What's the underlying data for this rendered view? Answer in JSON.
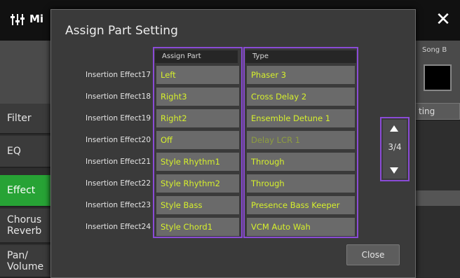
{
  "app": {
    "title": "Mi",
    "close_glyph": "✕",
    "song_label": "Song B",
    "partial_button": "ting"
  },
  "sidebar": {
    "tabs": [
      {
        "label": "Filter",
        "active": false
      },
      {
        "label": "EQ",
        "active": false
      },
      {
        "label": "Effect",
        "active": true
      },
      {
        "label": "Chorus Reverb",
        "active": false
      },
      {
        "label": "Pan/ Volume",
        "active": false
      }
    ]
  },
  "dialog": {
    "title": "Assign Part Setting",
    "columns": {
      "assign_part": "Assign Part",
      "type": "Type"
    },
    "rows": [
      {
        "label": "Insertion Effect17",
        "part": "Left",
        "type": "Phaser 3",
        "type_dim": false
      },
      {
        "label": "Insertion Effect18",
        "part": "Right3",
        "type": "Cross Delay 2",
        "type_dim": false
      },
      {
        "label": "Insertion Effect19",
        "part": "Right2",
        "type": "Ensemble Detune 1",
        "type_dim": false
      },
      {
        "label": "Insertion Effect20",
        "part": "Off",
        "type": "Delay LCR 1",
        "type_dim": true
      },
      {
        "label": "Insertion Effect21",
        "part": "Style Rhythm1",
        "type": "Through",
        "type_dim": false
      },
      {
        "label": "Insertion Effect22",
        "part": "Style Rhythm2",
        "type": "Through",
        "type_dim": false
      },
      {
        "label": "Insertion Effect23",
        "part": "Style Bass",
        "type": "Presence Bass Keeper",
        "type_dim": false
      },
      {
        "label": "Insertion Effect24",
        "part": "Style Chord1",
        "type": "VCM Auto Wah",
        "type_dim": false
      }
    ],
    "pager": {
      "page": "3/4"
    },
    "close_label": "Close"
  },
  "colors": {
    "value_text": "#d6f02c",
    "highlight_outline": "#8a4bd6",
    "active_tab": "#27a335"
  }
}
